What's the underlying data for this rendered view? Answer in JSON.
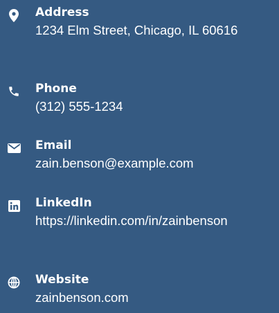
{
  "contact": {
    "items": [
      {
        "icon": "map-marker-icon",
        "label": "Address",
        "value": "1234 Elm Street, Chicago, IL 60616"
      },
      {
        "icon": "phone-icon",
        "label": "Phone",
        "value": "(312) 555-1234"
      },
      {
        "icon": "envelope-icon",
        "label": "Email",
        "value": "zain.benson@example.com"
      },
      {
        "icon": "linkedin-icon",
        "label": "LinkedIn",
        "value": "https://linkedin.com/in/zainbenson"
      },
      {
        "icon": "globe-icon",
        "label": "Website",
        "value": "zainbenson.com"
      }
    ]
  },
  "colors": {
    "background": "#355a82",
    "text": "#ffffff"
  }
}
